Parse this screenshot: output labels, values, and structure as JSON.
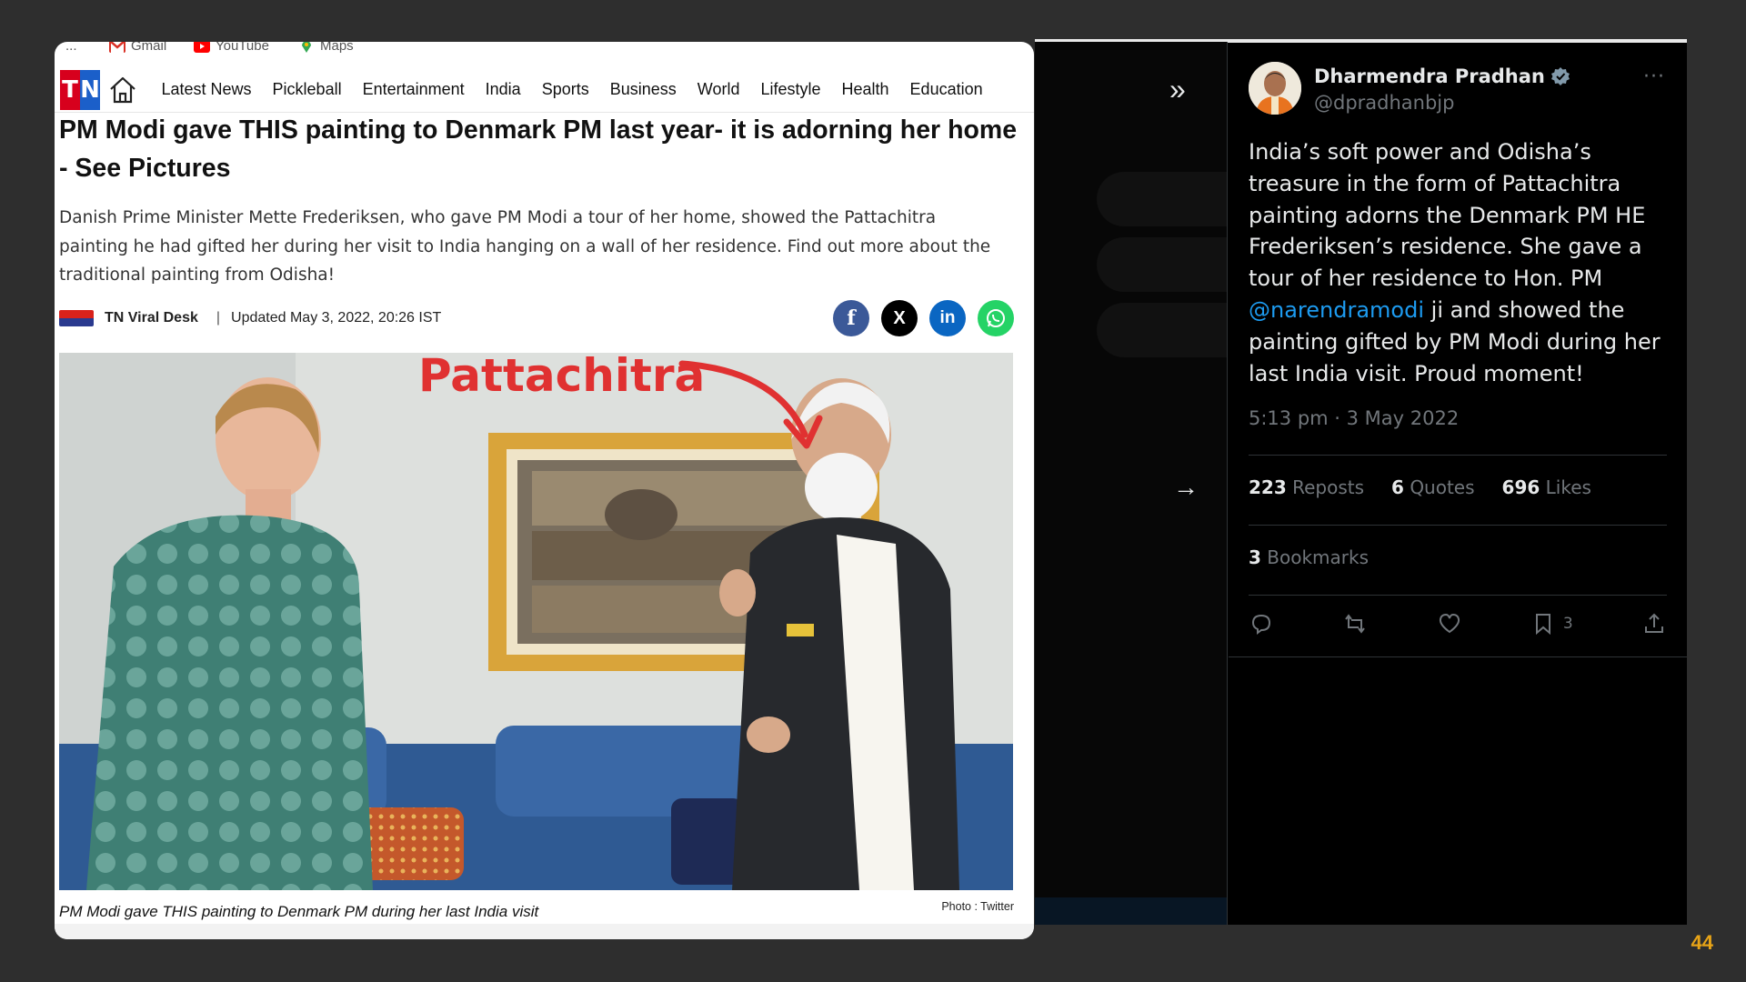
{
  "bookmarks_bar": {
    "overflow": "...",
    "items": [
      {
        "label": "Gmail",
        "icon": "gmail-icon",
        "color": "#d93025"
      },
      {
        "label": "YouTube",
        "icon": "youtube-icon",
        "color": "#ff0000"
      },
      {
        "label": "Maps",
        "icon": "maps-pin-icon",
        "color": "#34a853"
      }
    ]
  },
  "site": {
    "logo_t": "T",
    "logo_n": "N",
    "nav": [
      "Latest News",
      "Pickleball",
      "Entertainment",
      "India",
      "Sports",
      "Business",
      "World",
      "Lifestyle",
      "Health",
      "Education"
    ]
  },
  "article": {
    "headline": "PM Modi gave THIS painting to Denmark PM last year- it is adorning her home - See Pictures",
    "summary": "Danish Prime Minister Mette Frederiksen, who gave PM Modi a tour of her home, showed the Pattachitra painting he had gifted her during her visit to India hanging on a wall of her residence. Find out more about the traditional painting from Odisha!",
    "author": "TN Viral Desk",
    "separator": "|",
    "updated": "Updated May 3, 2022, 20:26 IST",
    "share": {
      "facebook": "f",
      "x": "X",
      "linkedin": "in",
      "whatsapp": "whatsapp"
    },
    "photo_annotation": "Pattachitra",
    "caption": "PM Modi gave THIS painting to Denmark PM during her last India visit",
    "photo_credit": "Photo : Twitter"
  },
  "tweet": {
    "name": "Dharmendra Pradhan",
    "handle": "@dpradhanbjp",
    "more": "···",
    "text_before": "India’s soft power and Odisha’s treasure in the form of Pattachitra painting adorns the Denmark PM HE Frederiksen’s residence. She gave a tour of her residence to Hon. PM ",
    "mention": "@narendramodi",
    "text_after": " ji and showed the painting gifted by PM Modi during her last India visit. Proud moment!",
    "time": "5:13 pm · 3 May 2022",
    "reposts_count": "223",
    "reposts_label": "Reposts",
    "quotes_count": "6",
    "quotes_label": "Quotes",
    "likes_count": "696",
    "likes_label": "Likes",
    "bookmarks_count": "3",
    "bookmarks_label": "Bookmarks",
    "bookmark_action_count": "3"
  },
  "slide": {
    "page_number": "44"
  },
  "colors": {
    "slide_bg": "#2e2e2e",
    "tn_red": "#d7001d",
    "tn_blue": "#1b5fc9",
    "twitter_blue": "#1d9bf0",
    "page_number": "#e8a417"
  }
}
